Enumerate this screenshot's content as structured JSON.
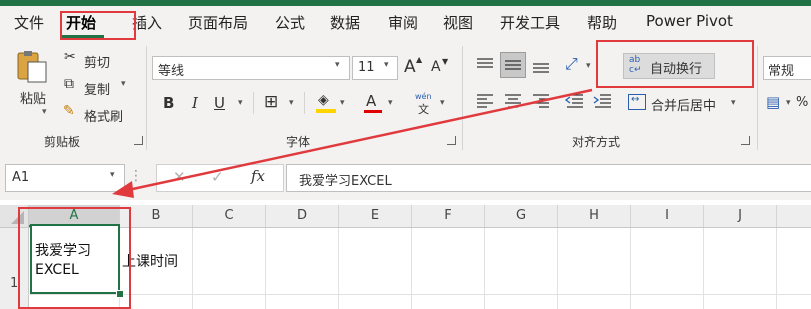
{
  "tabs": [
    "文件",
    "开始",
    "插入",
    "页面布局",
    "公式",
    "数据",
    "审阅",
    "视图",
    "开发工具",
    "帮助",
    "Power Pivot"
  ],
  "clipboard": {
    "paste_label": "粘贴",
    "cut_label": "剪切",
    "copy_label": "复制",
    "format_painter_label": "格式刷",
    "group_label": "剪贴板"
  },
  "font": {
    "font_name": "等线",
    "font_size": "11",
    "grow_label": "A",
    "shrink_label": "A",
    "bold": "B",
    "italic": "I",
    "underline": "U",
    "font_color_label": "A",
    "phonetic_top": "wén",
    "phonetic_bottom": "文",
    "group_label": "字体"
  },
  "alignment": {
    "wrap_text_label": "自动换行",
    "merge_center_label": "合并后居中",
    "group_label": "对齐方式"
  },
  "number": {
    "format_value": "常规"
  },
  "formula_bar": {
    "name_box": "A1",
    "fx_label": "fx",
    "formula_value": "我爱学习EXCEL"
  },
  "sheet": {
    "columns": [
      "A",
      "B",
      "C",
      "D",
      "E",
      "F",
      "G",
      "H",
      "I",
      "J"
    ],
    "row_number": "1",
    "a1_line1": "我爱学习",
    "a1_line2": "EXCEL",
    "b1_value": "上课时间"
  },
  "colors": {
    "accent": "#217346",
    "annotation": "#e03a3e"
  }
}
